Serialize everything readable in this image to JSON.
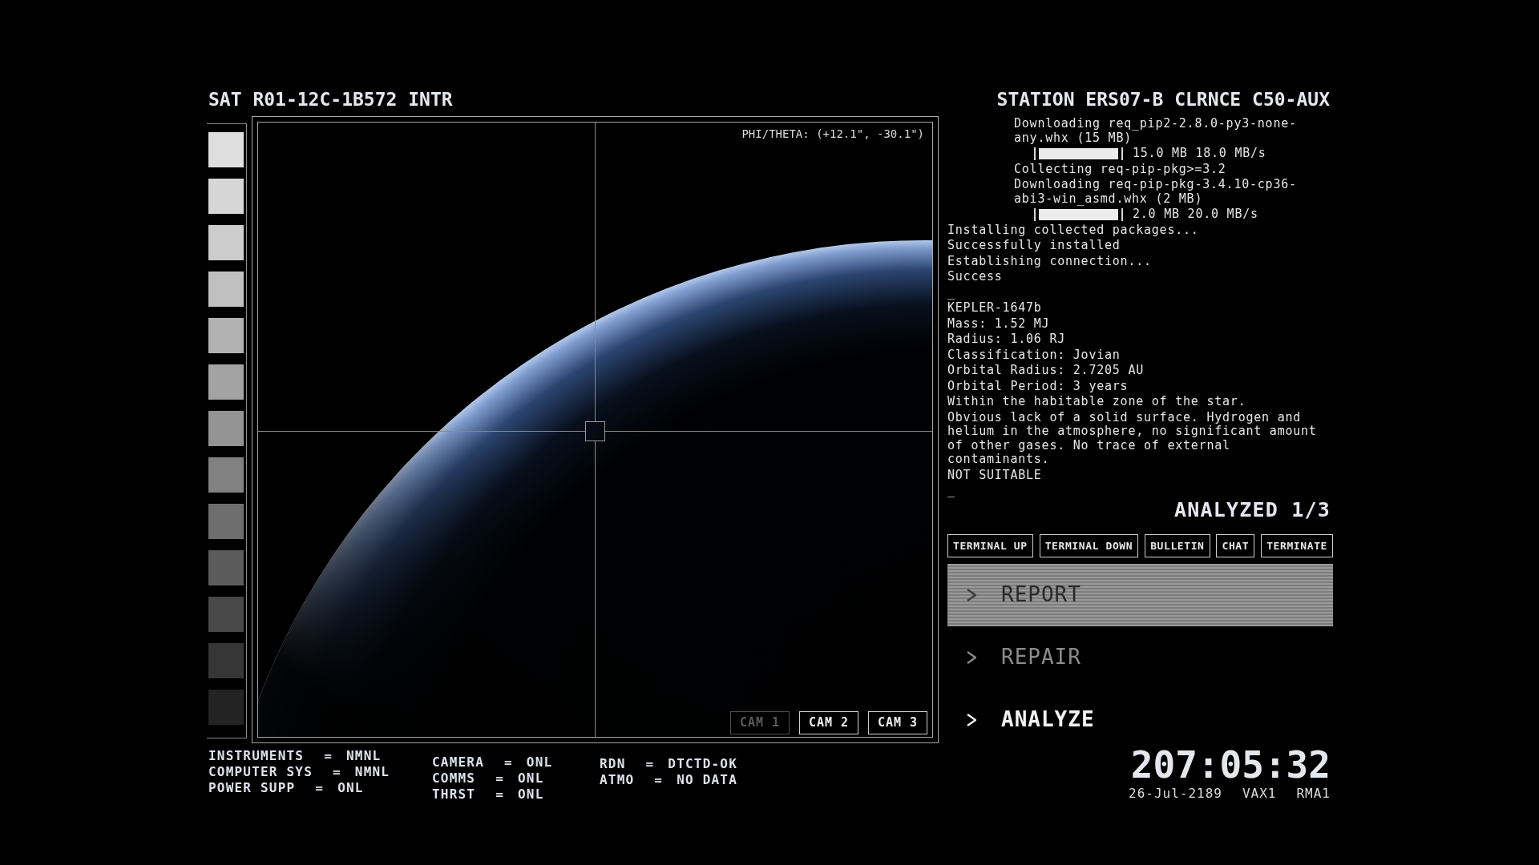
{
  "left_panel": {
    "title": "SAT R01-12C-1B572 INTR",
    "swatches": [
      {
        "color": "#dedede"
      },
      {
        "color": "#d6d6d6"
      },
      {
        "color": "#cccccc"
      },
      {
        "color": "#c0c0c0"
      },
      {
        "color": "#b2b2b2"
      },
      {
        "color": "#a3a3a3"
      },
      {
        "color": "#939393"
      },
      {
        "color": "#818181"
      },
      {
        "color": "#6e6e6e"
      },
      {
        "color": "#5b5b5b"
      },
      {
        "color": "#484848"
      },
      {
        "color": "#363636"
      },
      {
        "color": "#232323"
      }
    ]
  },
  "viewport": {
    "coordinates": "PHI/THETA: (+12.1\", -30.1\")",
    "cameras": [
      {
        "label": "CAM 1",
        "disabled": true
      },
      {
        "label": "CAM 2",
        "disabled": false
      },
      {
        "label": "CAM 3",
        "disabled": false
      }
    ]
  },
  "status_columns": [
    {
      "rows": [
        {
          "label": "INSTRUMENTS",
          "separator": "=",
          "value": "NMNL"
        },
        {
          "label": "COMPUTER SYS",
          "separator": "=",
          "value": "NMNL"
        },
        {
          "label": "POWER SUPP",
          "separator": "=",
          "value": "ONL"
        }
      ]
    },
    {
      "rows": [
        {
          "label": "CAMERA",
          "separator": "=",
          "value": "ONL"
        },
        {
          "label": "COMMS",
          "separator": "=",
          "value": "ONL"
        },
        {
          "label": "THRST",
          "separator": "=",
          "value": "ONL"
        }
      ]
    },
    {
      "rows": [
        {
          "label": "RDN",
          "separator": "=",
          "value": "DTCTD-OK"
        },
        {
          "label": "ATMO",
          "separator": "=",
          "value": "NO DATA"
        }
      ]
    }
  ],
  "right_panel": {
    "title": "STATION ERS07-B CLRNCE C50-AUX",
    "terminal": [
      {
        "kind": "detail",
        "text": "Downloading req_pip2-2.8.0-py3-none-any.whx (15 MB)"
      },
      {
        "kind": "progress",
        "level": 1,
        "text": "15.0 MB 18.0 MB/s"
      },
      {
        "kind": "detail",
        "text": "Collecting req-pip-pkg>=3.2"
      },
      {
        "kind": "detail",
        "text": "Downloading req-pip-pkg-3.4.10-cp36-abi3-win_asmd.whx (2 MB)"
      },
      {
        "kind": "progress",
        "level": 1,
        "text": "2.0 MB 20.0 MB/s"
      },
      {
        "kind": "output",
        "text": "Installing collected packages..."
      },
      {
        "kind": "output",
        "text": "Successfully installed"
      },
      {
        "kind": "output",
        "text": "Establishing connection..."
      },
      {
        "kind": "output",
        "text": "Success"
      },
      {
        "kind": "output",
        "text": "_"
      },
      {
        "kind": "output",
        "text": "KEPLER-1647b"
      },
      {
        "kind": "output",
        "text": "Mass: 1.52 MJ"
      },
      {
        "kind": "output",
        "text": "Radius: 1.06 RJ"
      },
      {
        "kind": "output",
        "text": "Classification: Jovian"
      },
      {
        "kind": "output",
        "text": "Orbital Radius: 2.7205 AU"
      },
      {
        "kind": "output",
        "text": "Orbital Period: 3 years"
      },
      {
        "kind": "output",
        "text": "Within the habitable zone of the star."
      },
      {
        "kind": "output",
        "text": "Obvious lack of a solid surface. Hydrogen and helium in the atmosphere, no significant amount of other gases. No trace of external contaminants."
      },
      {
        "kind": "output",
        "text": "NOT SUITABLE"
      },
      {
        "kind": "output",
        "text": "_"
      }
    ],
    "analyzed": "ANALYZED 1/3",
    "commands": [
      "TERMINAL UP",
      "TERMINAL DOWN",
      "BULLETIN",
      "CHAT",
      "TERMINATE"
    ],
    "menu": [
      {
        "label": "REPORT",
        "selected": true,
        "disabled": false
      },
      {
        "label": "REPAIR",
        "selected": false,
        "disabled": true
      },
      {
        "label": "ANALYZE",
        "selected": false,
        "disabled": false
      }
    ],
    "clock": {
      "time": "207:05:32",
      "date": "26-Jul-2189",
      "codes": [
        "VAX1",
        "RMA1"
      ]
    }
  }
}
